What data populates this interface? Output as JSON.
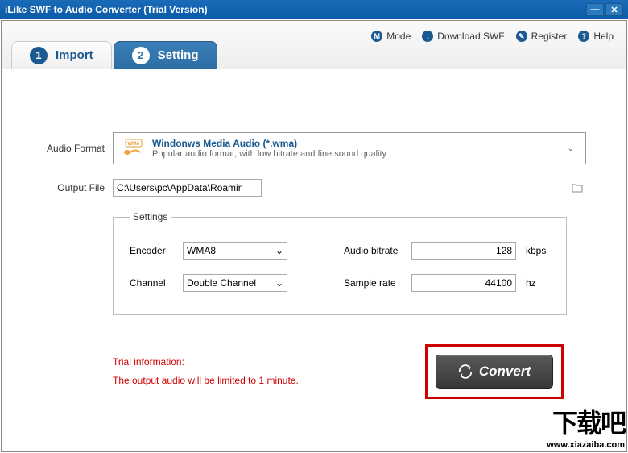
{
  "window": {
    "title": "iLike SWF to Audio Converter (Trial Version)"
  },
  "toolbar": {
    "mode": "Mode",
    "download_swf": "Download SWF",
    "register": "Register",
    "help": "Help"
  },
  "tabs": {
    "import": {
      "num": "1",
      "label": "Import"
    },
    "setting": {
      "num": "2",
      "label": "Setting"
    }
  },
  "format": {
    "label": "Audio Format",
    "title": "Windonws Media Audio (*.wma)",
    "desc": "Popular audio format, with low bitrate and fine sound quality",
    "badge": "WMA"
  },
  "output": {
    "label": "Output File",
    "value": "C:\\Users\\pc\\AppData\\Roaming\\iLike\\SWF to Audio Converter\\Sample.wma"
  },
  "settings": {
    "legend": "Settings",
    "encoder_label": "Encoder",
    "encoder_value": "WMA8",
    "channel_label": "Channel",
    "channel_value": "Double Channel",
    "bitrate_label": "Audio bitrate",
    "bitrate_value": "128",
    "bitrate_unit": "kbps",
    "samplerate_label": "Sample rate",
    "samplerate_value": "44100",
    "samplerate_unit": "hz"
  },
  "trial": {
    "line1": "Trial information:",
    "line2": "The output audio will be limited to 1 minute."
  },
  "convert_label": "Convert",
  "watermark": {
    "big": "下载吧",
    "small": "www.xiazaiba.com"
  }
}
